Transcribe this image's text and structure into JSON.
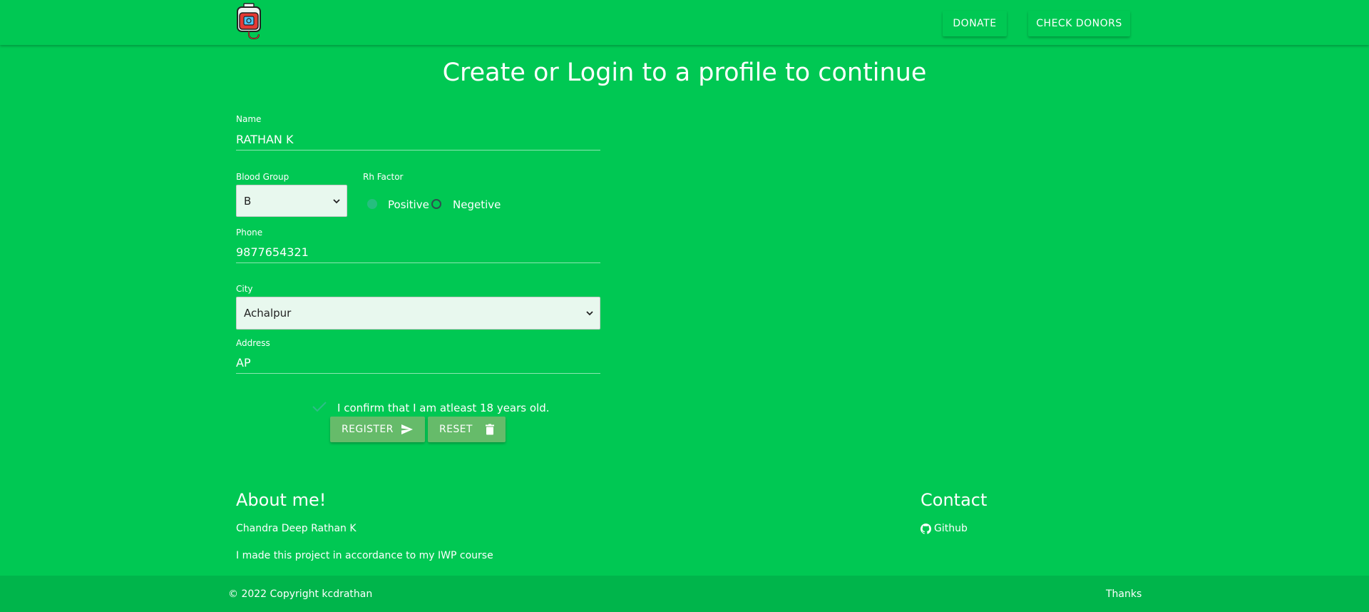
{
  "nav": {
    "logo_icon": "blood-bag-icon",
    "donate_label": "DONATE",
    "check_donors_label": "CHECK DONORS"
  },
  "page": {
    "title": "Create or Login to a profile to continue"
  },
  "form": {
    "name": {
      "label": "Name",
      "value": "RATHAN K"
    },
    "blood_group": {
      "label": "Blood Group",
      "selected": "B"
    },
    "rh_factor": {
      "label": "Rh Factor",
      "options": [
        "Positive",
        "Negetive"
      ],
      "selected": "Positive"
    },
    "phone": {
      "label": "Phone",
      "value": "9877654321"
    },
    "city": {
      "label": "City",
      "selected": "Achalpur"
    },
    "address": {
      "label": "Address",
      "value": "AP"
    },
    "confirm_text": "I confirm that I am atleast 18 years old.",
    "confirm_checked": true,
    "register_label": "REGISTER",
    "reset_label": "RESET"
  },
  "footer": {
    "about_title": "About me!",
    "author": "Chandra Deep Rathan K",
    "description": "I made this project in accordance to my IWP course",
    "contact_title": "Contact",
    "github_label": "Github",
    "copyright": "© 2022 Copyright kcdrathan",
    "thanks": "Thanks"
  },
  "colors": {
    "background": "#00c853",
    "button": "#66bb6a",
    "footer_bar": "#00b54b",
    "select_bg": "#e8f8ee"
  }
}
